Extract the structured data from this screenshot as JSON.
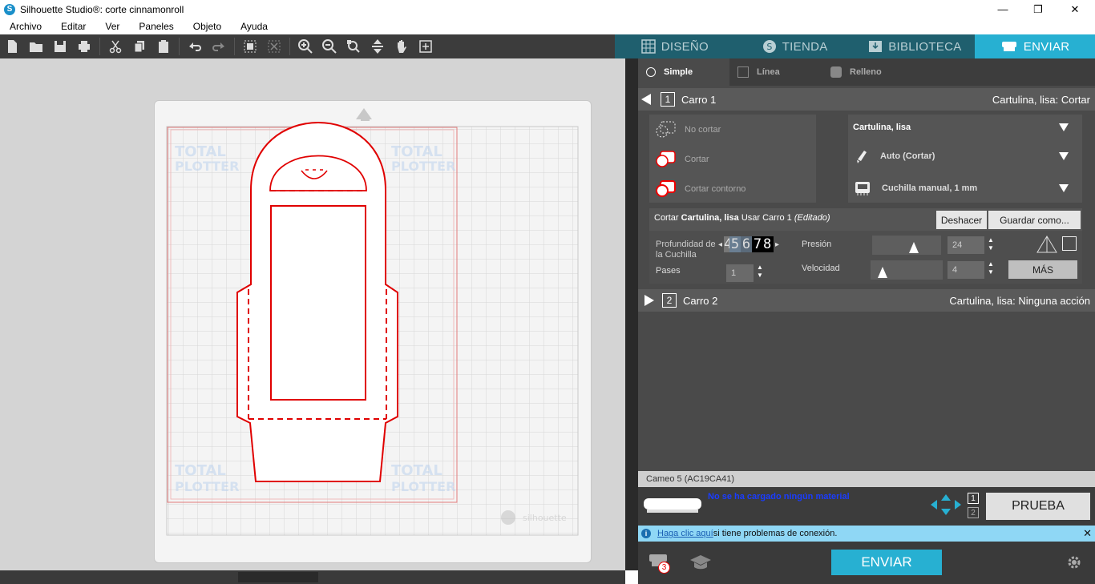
{
  "window": {
    "title": "Silhouette Studio®: corte cinnamonroll",
    "minimize": "—",
    "restore": "❐",
    "close": "✕"
  },
  "menu": [
    "Archivo",
    "Editar",
    "Ver",
    "Paneles",
    "Objeto",
    "Ayuda"
  ],
  "tabs": {
    "diseno": "DISEÑO",
    "tienda": "TIENDA",
    "biblioteca": "BIBLIOTECA",
    "enviar": "ENVIAR"
  },
  "subtabs": {
    "simple": "Simple",
    "linea": "Línea",
    "relleno": "Relleno"
  },
  "carro1": {
    "num": "1",
    "label": "Carro 1",
    "status": "Cartulina, lisa: Cortar"
  },
  "actions": {
    "no_cortar": "No cortar",
    "cortar": "Cortar",
    "cortar_contorno": "Cortar contorno"
  },
  "material": {
    "name": "Cartulina, lisa",
    "tool": "Auto (Cortar)",
    "blade": "Cuchilla manual, 1 mm"
  },
  "cut_line": {
    "prefix": "Cortar ",
    "material": "Cartulina, lisa",
    "mid": " Usar Carro 1 ",
    "edited": "(Editado)"
  },
  "buttons": {
    "deshacer": "Deshacer",
    "guardar": "Guardar como...",
    "mas": "MÁS",
    "prueba": "PRUEBA",
    "enviar": "ENVIAR"
  },
  "settings": {
    "depth_label": "Profundidad de la Cuchilla",
    "depth_digits": [
      "4",
      "5",
      "6",
      "7",
      "8"
    ],
    "depth_value": 7,
    "pressure_label": "Presión",
    "pressure": "24",
    "pressure_level": 0.62,
    "passes_label": "Pases",
    "passes": "1",
    "speed_label": "Velocidad",
    "speed": "4",
    "speed_level": 0.12
  },
  "carro2": {
    "num": "2",
    "label": "Carro 2",
    "status": "Cartulina, lisa: Ninguna acción"
  },
  "device": {
    "name": "Cameo 5 (AC19CA41)",
    "material_status": "No se ha cargado ningún material",
    "carro_a": "1",
    "carro_b": "2"
  },
  "info": {
    "link": "Haga clic aquí",
    "text": " si tiene problemas de conexión."
  },
  "footer": {
    "badge": "3"
  },
  "mat": {
    "watermark": "silhouette",
    "brand_line1": "TOTAL",
    "brand_line2": "PLOTTER"
  },
  "colors": {
    "accent": "#27b0d2",
    "cut_red": "#e00000",
    "link_blue": "#0000ee"
  }
}
